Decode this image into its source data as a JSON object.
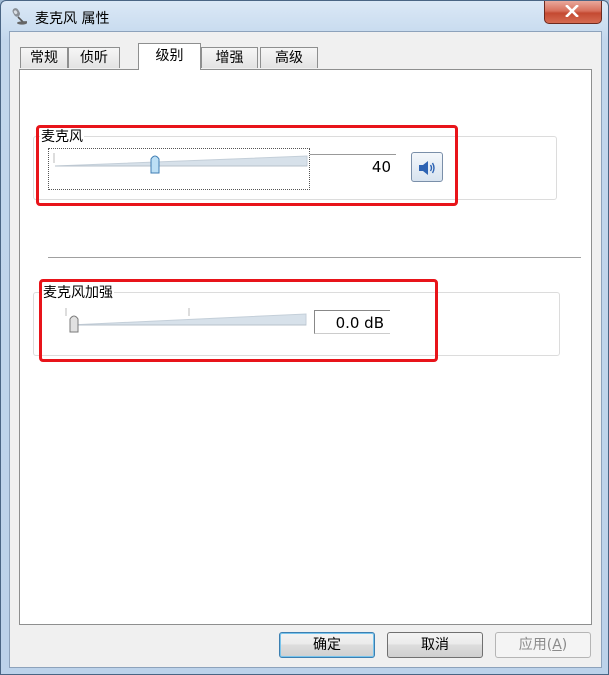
{
  "window": {
    "title": "麦克风 属性",
    "icon": "microphone-icon",
    "close_icon": "close-icon"
  },
  "tabs": [
    {
      "label": "常规",
      "active": false
    },
    {
      "label": "侦听",
      "active": false
    },
    {
      "label": "级别",
      "active": true
    },
    {
      "label": "增强",
      "active": false
    },
    {
      "label": "高级",
      "active": false
    }
  ],
  "microphone": {
    "label": "麦克风",
    "value": "40",
    "level_fraction": 0.4,
    "mute_icon": "speaker-icon"
  },
  "boost": {
    "label": "麦克风加强",
    "value": "0.0 dB",
    "level_fraction": 0.0
  },
  "buttons": {
    "ok": "确定",
    "cancel": "取消",
    "apply_prefix": "应用(",
    "apply_accel": "A",
    "apply_suffix": ")"
  },
  "colors": {
    "highlight_box": "#e8141a"
  }
}
